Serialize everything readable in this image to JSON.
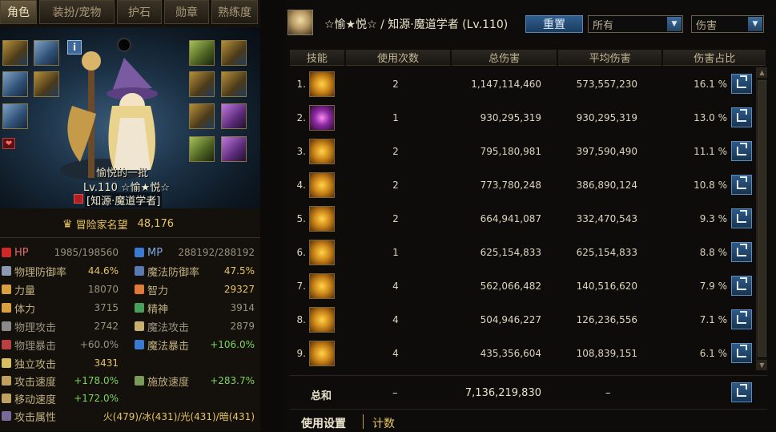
{
  "left": {
    "tabs": [
      "角色",
      "装扮/宠物",
      "护石",
      "勋章",
      "熟练度"
    ],
    "character": {
      "name": "愉悦的一批",
      "level_line": "Lv.110 ☆愉★悦☆",
      "class_line": "[知源·魔道学者]"
    },
    "fame": {
      "label": "冒险家名望",
      "value": "48,176"
    },
    "stats": {
      "hp": {
        "label": "HP",
        "value": "1985/198560"
      },
      "mp": {
        "label": "MP",
        "value": "288192/288192"
      },
      "phys_def": {
        "label": "物理防御率",
        "value": "44.6%"
      },
      "mag_def": {
        "label": "魔法防御率",
        "value": "47.5%"
      },
      "str": {
        "label": "力量",
        "value": "18070"
      },
      "int": {
        "label": "智力",
        "value": "29327"
      },
      "vit": {
        "label": "体力",
        "value": "3715"
      },
      "spi": {
        "label": "精神",
        "value": "3914"
      },
      "phys_atk": {
        "label": "物理攻击",
        "value": "2742"
      },
      "mag_atk": {
        "label": "魔法攻击",
        "value": "2879"
      },
      "phys_crit": {
        "label": "物理暴击",
        "value": "+60.0%"
      },
      "mag_crit": {
        "label": "魔法暴击",
        "value": "+106.0%"
      },
      "ind_atk": {
        "label": "独立攻击",
        "value": "3431"
      },
      "atk_speed": {
        "label": "攻击速度",
        "value": "+178.0%"
      },
      "cast_speed": {
        "label": "施放速度",
        "value": "+283.7%"
      },
      "move_speed": {
        "label": "移动速度",
        "value": "+172.0%"
      },
      "element": {
        "label": "攻击属性",
        "value": "火(479)/冰(431)/光(431)/暗(431)"
      }
    }
  },
  "right": {
    "title": "☆愉★悦☆ / 知源·魔道学者 (Lv.110)",
    "reset_label": "重置",
    "filter1": "所有",
    "filter2": "伤害",
    "columns": [
      "技能",
      "使用次数",
      "总伤害",
      "平均伤害",
      "伤害占比"
    ],
    "rows": [
      {
        "n": "1.",
        "count": "2",
        "total": "1,147,114,460",
        "avg": "573,557,230",
        "pct": "16.1 %"
      },
      {
        "n": "2.",
        "count": "1",
        "total": "930,295,319",
        "avg": "930,295,319",
        "pct": "13.0 %"
      },
      {
        "n": "3.",
        "count": "2",
        "total": "795,180,981",
        "avg": "397,590,490",
        "pct": "11.1 %"
      },
      {
        "n": "4.",
        "count": "2",
        "total": "773,780,248",
        "avg": "386,890,124",
        "pct": "10.8 %"
      },
      {
        "n": "5.",
        "count": "2",
        "total": "664,941,087",
        "avg": "332,470,543",
        "pct": "9.3 %"
      },
      {
        "n": "6.",
        "count": "1",
        "total": "625,154,833",
        "avg": "625,154,833",
        "pct": "8.8 %"
      },
      {
        "n": "7.",
        "count": "4",
        "total": "562,066,482",
        "avg": "140,516,620",
        "pct": "7.9 %"
      },
      {
        "n": "8.",
        "count": "4",
        "total": "504,946,227",
        "avg": "126,236,556",
        "pct": "7.1 %"
      },
      {
        "n": "9.",
        "count": "4",
        "total": "435,356,604",
        "avg": "108,839,151",
        "pct": "6.1 %"
      }
    ],
    "total": {
      "label": "总和",
      "count": "–",
      "total": "7,136,219,830",
      "avg": "–"
    },
    "bottom_tabs": [
      "使用设置",
      "计数"
    ]
  },
  "colors": {
    "accent_blue": "#2f5f8f",
    "gold": "#e6c560",
    "green": "#7fd35a"
  }
}
